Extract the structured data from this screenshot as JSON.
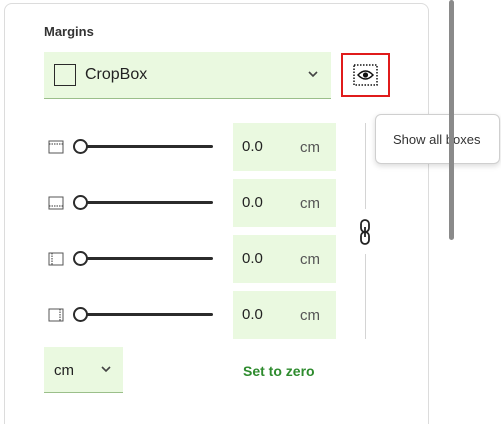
{
  "margins": {
    "title": "Margins",
    "box_select": {
      "value": "CropBox"
    },
    "show_boxes_tooltip": "Show all boxes",
    "rows": [
      {
        "side": "top",
        "value": "0.0",
        "unit": "cm"
      },
      {
        "side": "bottom",
        "value": "0.0",
        "unit": "cm"
      },
      {
        "side": "left",
        "value": "0.0",
        "unit": "cm"
      },
      {
        "side": "right",
        "value": "0.0",
        "unit": "cm"
      }
    ],
    "unit_select": {
      "value": "cm"
    },
    "set_zero_label": "Set to zero"
  },
  "colors": {
    "accent_green": "#2e8b2e",
    "field_background": "#eaf9e0",
    "highlight_border": "#e01b1b"
  },
  "icons": {
    "box_swatch": "square-swatch-icon",
    "dropdown": "chevron-down-icon",
    "show_boxes": "eye-in-dashed-box-icon",
    "link": "chain-link-icon",
    "margin_sides": [
      "margin-top-icon",
      "margin-bottom-icon",
      "margin-left-icon",
      "margin-right-icon"
    ]
  }
}
